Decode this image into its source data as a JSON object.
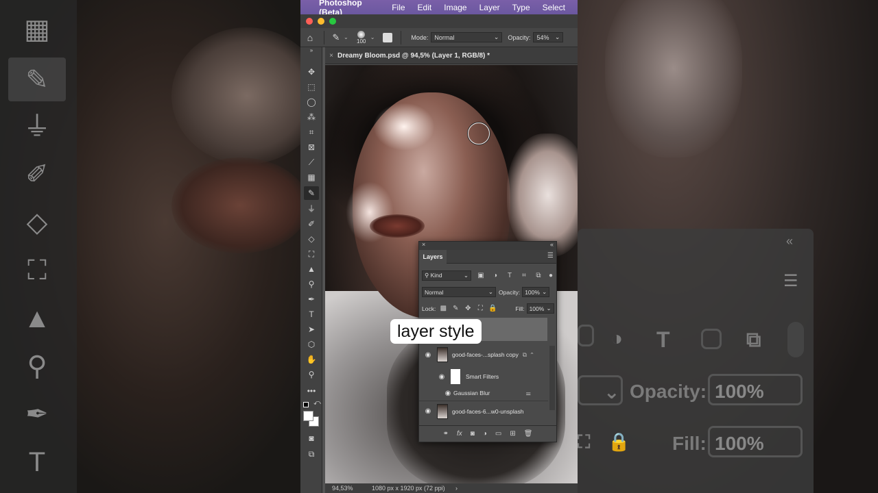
{
  "menubar": {
    "app_name": "Photoshop (Beta)",
    "items": [
      "File",
      "Edit",
      "Image",
      "Layer",
      "Type",
      "Select"
    ]
  },
  "options": {
    "brush_size": "100",
    "mode_label": "Mode:",
    "mode_value": "Normal",
    "opacity_label": "Opacity:",
    "opacity_value": "54%"
  },
  "document": {
    "tab_title": "Dreamy Bloom.psd @ 94,5% (Layer 1, RGB/8) *",
    "zoom": "94,53%",
    "dimensions": "1080 px x 1920 px (72 ppi)"
  },
  "layers_panel": {
    "title": "Layers",
    "filter_kind": "Kind",
    "blend_mode": "Normal",
    "opacity_label": "Opacity:",
    "opacity_value": "100%",
    "lock_label": "Lock:",
    "fill_label": "Fill:",
    "fill_value": "100%",
    "layers": [
      {
        "name": "good-faces-...splash copy"
      },
      {
        "name": "Smart Filters"
      },
      {
        "name": "Gaussian Blur"
      },
      {
        "name": "good-faces-6...w0-unsplash"
      }
    ]
  },
  "caption": "layer style",
  "background_zoom": {
    "opacity_label": "Opacity:",
    "opacity_value": "100%",
    "fill_label": "Fill:",
    "fill_value": "100%"
  },
  "colors": {
    "menubar": "#6b58a0",
    "panel": "#4a4a4a",
    "toolbar": "#424242"
  }
}
